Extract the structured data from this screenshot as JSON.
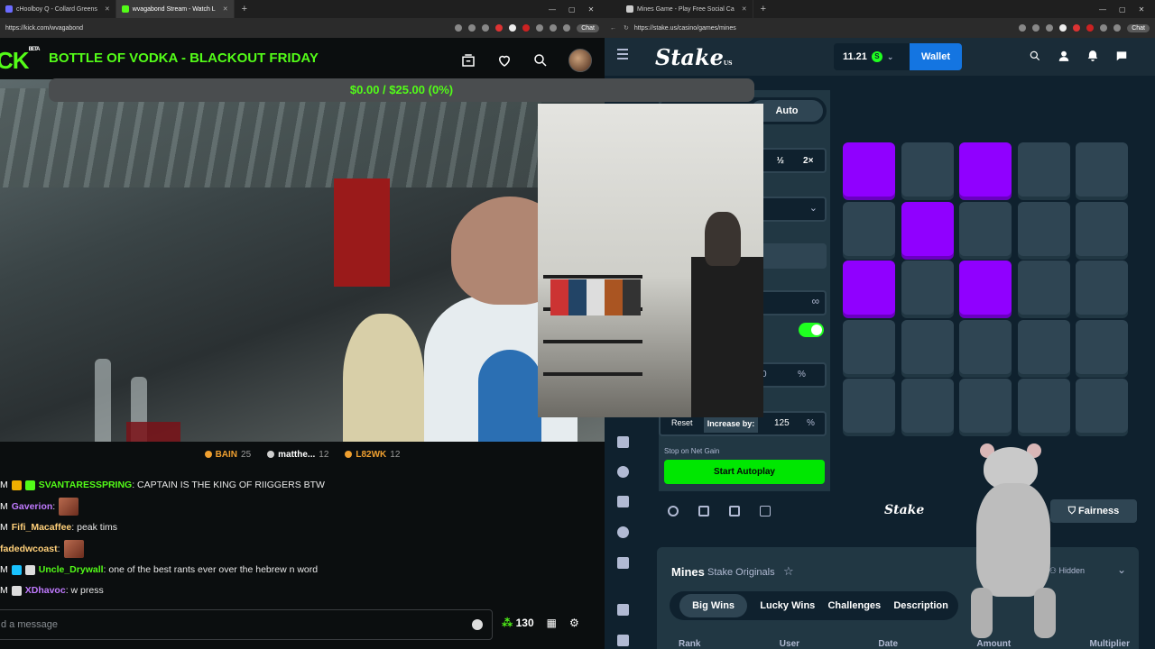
{
  "left_browser": {
    "tabs": [
      {
        "label": "cHoolboy Q - Collard Greens",
        "favicon": "#6b6bff",
        "active": false
      },
      {
        "label": "wvagabond Stream - Watch L",
        "favicon": "#53fc18",
        "active": true
      }
    ],
    "url": "https://kick.com/wvagabond",
    "chat_pill": "Chat"
  },
  "kick": {
    "logo": "CK",
    "logo_badge": "BETA",
    "stream_title": "BOTTLE OF VODKA - BLACKOUT FRIDAY",
    "goal_text": "$0.00 / $25.00 (0%)",
    "goal_progress": 0,
    "leaders": [
      {
        "name": "BAIN",
        "count": "25",
        "color": "#f0a030"
      },
      {
        "name": "matthe...",
        "count": "12",
        "color": "#cfcfcf"
      },
      {
        "name": "L82WK",
        "count": "12",
        "color": "#f0a030"
      }
    ],
    "chat": [
      {
        "prefix": "M",
        "name": "SVANTARESSPRING",
        "name_color": "#53fc18",
        "text": ": CAPTAIN IS THE KING OF RIIGGERS BTW",
        "badges": [
          "#f0b000",
          "#53fc18"
        ],
        "emote": false
      },
      {
        "prefix": "M",
        "name": "Gaverion",
        "name_color": "#c07aff",
        "text": ":",
        "badges": [],
        "emote": true
      },
      {
        "prefix": "M",
        "name": "Fifi_Macaffee",
        "name_color": "#ffd07a",
        "text": ": peak tims",
        "badges": [],
        "emote": false
      },
      {
        "prefix": "",
        "name": "fadedwcoast",
        "name_color": "#ffd07a",
        "text": ":",
        "badges": [],
        "emote": true
      },
      {
        "prefix": "M",
        "name": "Uncle_Drywall",
        "name_color": "#53fc18",
        "text": ": one of the best rants ever over the hebrew n word",
        "badges": [
          "#19c2ff",
          "#dddddd"
        ],
        "emote": false
      },
      {
        "prefix": "M",
        "name": "XDhavoc",
        "name_color": "#c07aff",
        "text": ": w press",
        "badges": [
          "#dddddd"
        ],
        "emote": false
      }
    ],
    "input_placeholder": "d a message",
    "points": "130"
  },
  "right_browser": {
    "tab_label": "Mines Game - Play Free Social Ca",
    "url": "https://stake.us/casino/games/mines",
    "chat_pill": "Chat"
  },
  "stake": {
    "logo": "Stake",
    "logo_suffix": "US",
    "balance": "11.21",
    "coin_label": "S",
    "wallet_label": "Wallet",
    "mode_tab": "Auto",
    "half_label": "½",
    "double_label": "2×",
    "infinity": "∞",
    "on_win_value": "0",
    "percent": "%",
    "reset_label": "Reset",
    "increase_label": "Increase by:",
    "increase_value": "125",
    "stop_net_gain": "Stop on Net Gain",
    "start_autoplay": "Start Autoplay",
    "footer_logo": "Stake",
    "fairness_label": "Fairness",
    "game_title": "Mines",
    "game_subtitle": "Stake Originals",
    "hidden_label": "Hidden",
    "tabs": [
      "Big Wins",
      "Lucky Wins",
      "Challenges",
      "Description"
    ],
    "columns": [
      "Rank",
      "User",
      "Date",
      "Amount",
      "Multiplier"
    ],
    "grid": [
      [
        1,
        0,
        1,
        0,
        0
      ],
      [
        0,
        1,
        0,
        0,
        0
      ],
      [
        1,
        0,
        1,
        0,
        0
      ],
      [
        0,
        0,
        0,
        0,
        0
      ],
      [
        0,
        0,
        0,
        0,
        0
      ]
    ],
    "colors": {
      "gem": "#9000ff",
      "tile": "#2f4553",
      "accent": "#00e701",
      "wallet": "#1475e1"
    }
  }
}
